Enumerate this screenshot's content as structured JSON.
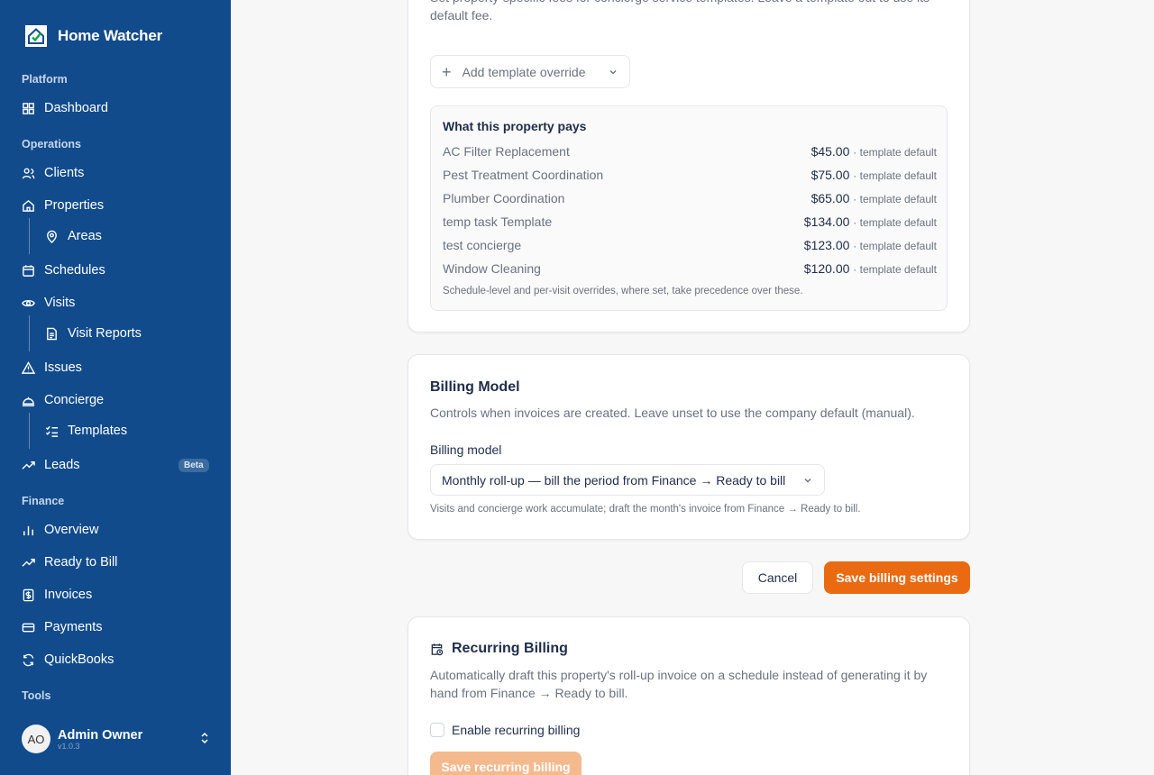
{
  "brand": {
    "name": "Home Watcher"
  },
  "sidebar": {
    "sections": {
      "platform": "Platform",
      "operations": "Operations",
      "finance": "Finance",
      "tools": "Tools"
    },
    "items": {
      "dashboard": "Dashboard",
      "clients": "Clients",
      "properties": "Properties",
      "areas": "Areas",
      "schedules": "Schedules",
      "visits": "Visits",
      "visit_reports": "Visit Reports",
      "issues": "Issues",
      "concierge": "Concierge",
      "templates": "Templates",
      "leads": "Leads",
      "leads_badge": "Beta",
      "overview": "Overview",
      "ready_to_bill": "Ready to Bill",
      "invoices": "Invoices",
      "payments": "Payments",
      "quickbooks": "QuickBooks"
    },
    "user": {
      "initials": "AO",
      "name": "Admin Owner",
      "version": "v1.0.3"
    }
  },
  "fees_card": {
    "description": "Set property-specific fees for concierge service templates. Leave a template out to use its default fee.",
    "add_override_label": "Add template override",
    "pays_title": "What this property pays",
    "rows": [
      {
        "name": "AC Filter Replacement",
        "amount": "$45.00",
        "tag": "· template default"
      },
      {
        "name": "Pest Treatment Coordination",
        "amount": "$75.00",
        "tag": "· template default"
      },
      {
        "name": "Plumber Coordination",
        "amount": "$65.00",
        "tag": "· template default"
      },
      {
        "name": "temp task Template",
        "amount": "$134.00",
        "tag": "· template default"
      },
      {
        "name": "test concierge",
        "amount": "$123.00",
        "tag": "· template default"
      },
      {
        "name": "Window Cleaning",
        "amount": "$120.00",
        "tag": "· template default"
      }
    ],
    "note": "Schedule-level and per-visit overrides, where set, take precedence over these."
  },
  "billing_model": {
    "title": "Billing Model",
    "description": "Controls when invoices are created. Leave unset to use the company default (manual).",
    "field_label": "Billing model",
    "selected": "Monthly roll-up — bill the period from Finance → Ready to bill",
    "help": "Visits and concierge work accumulate; draft the month's invoice from Finance → Ready to bill."
  },
  "actions": {
    "cancel": "Cancel",
    "save": "Save billing settings"
  },
  "recurring": {
    "title": "Recurring Billing",
    "description": "Automatically draft this property's roll-up invoice on a schedule instead of generating it by hand from Finance → Ready to bill.",
    "checkbox_label": "Enable recurring billing",
    "save_label": "Save recurring billing"
  },
  "colors": {
    "sidebar": "#114b8b",
    "accent": "#ea6a12"
  }
}
